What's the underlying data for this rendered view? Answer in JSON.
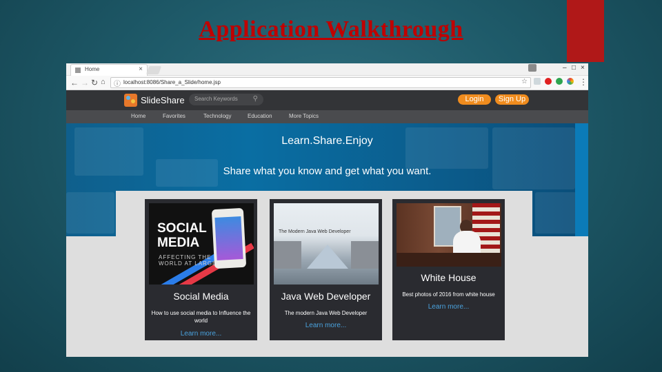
{
  "slide": {
    "title": "Application Walkthrough"
  },
  "browser": {
    "tab_title": "Home",
    "url": "localhost:8086/Share_a_Slide/home.jsp",
    "tab_close": "×",
    "window_min": "–",
    "window_max": "□",
    "window_close": "×"
  },
  "site": {
    "logo": "SlideShare",
    "search_placeholder": "Search Keywords",
    "login": "Login",
    "signup": "Sign Up",
    "nav": [
      "Home",
      "Favorites",
      "Technology",
      "Education",
      "More Topics"
    ]
  },
  "hero": {
    "title": "Learn.Share.Enjoy",
    "subtitle": "Share what you know and get what you want."
  },
  "cards": [
    {
      "title": "Social Media",
      "description": "How to use social media to Influence the world",
      "link": "Learn more...",
      "image_text": {
        "line1": "SOCIAL",
        "line2": "MEDIA",
        "small1": "AFFECTING THE",
        "small2": "WORLD AT LARGE"
      }
    },
    {
      "title": "Java Web Developer",
      "description": "The modern Java Web Developer",
      "link": "Learn more...",
      "image_text": {
        "line1": "The Modern Java Web Developer"
      }
    },
    {
      "title": "White House",
      "description": "Best photos of 2016 from white house",
      "link": "Learn more..."
    }
  ],
  "colors": {
    "accent_orange": "#f08c1e",
    "link_blue": "#4aa3df",
    "title_red": "#c00000"
  }
}
